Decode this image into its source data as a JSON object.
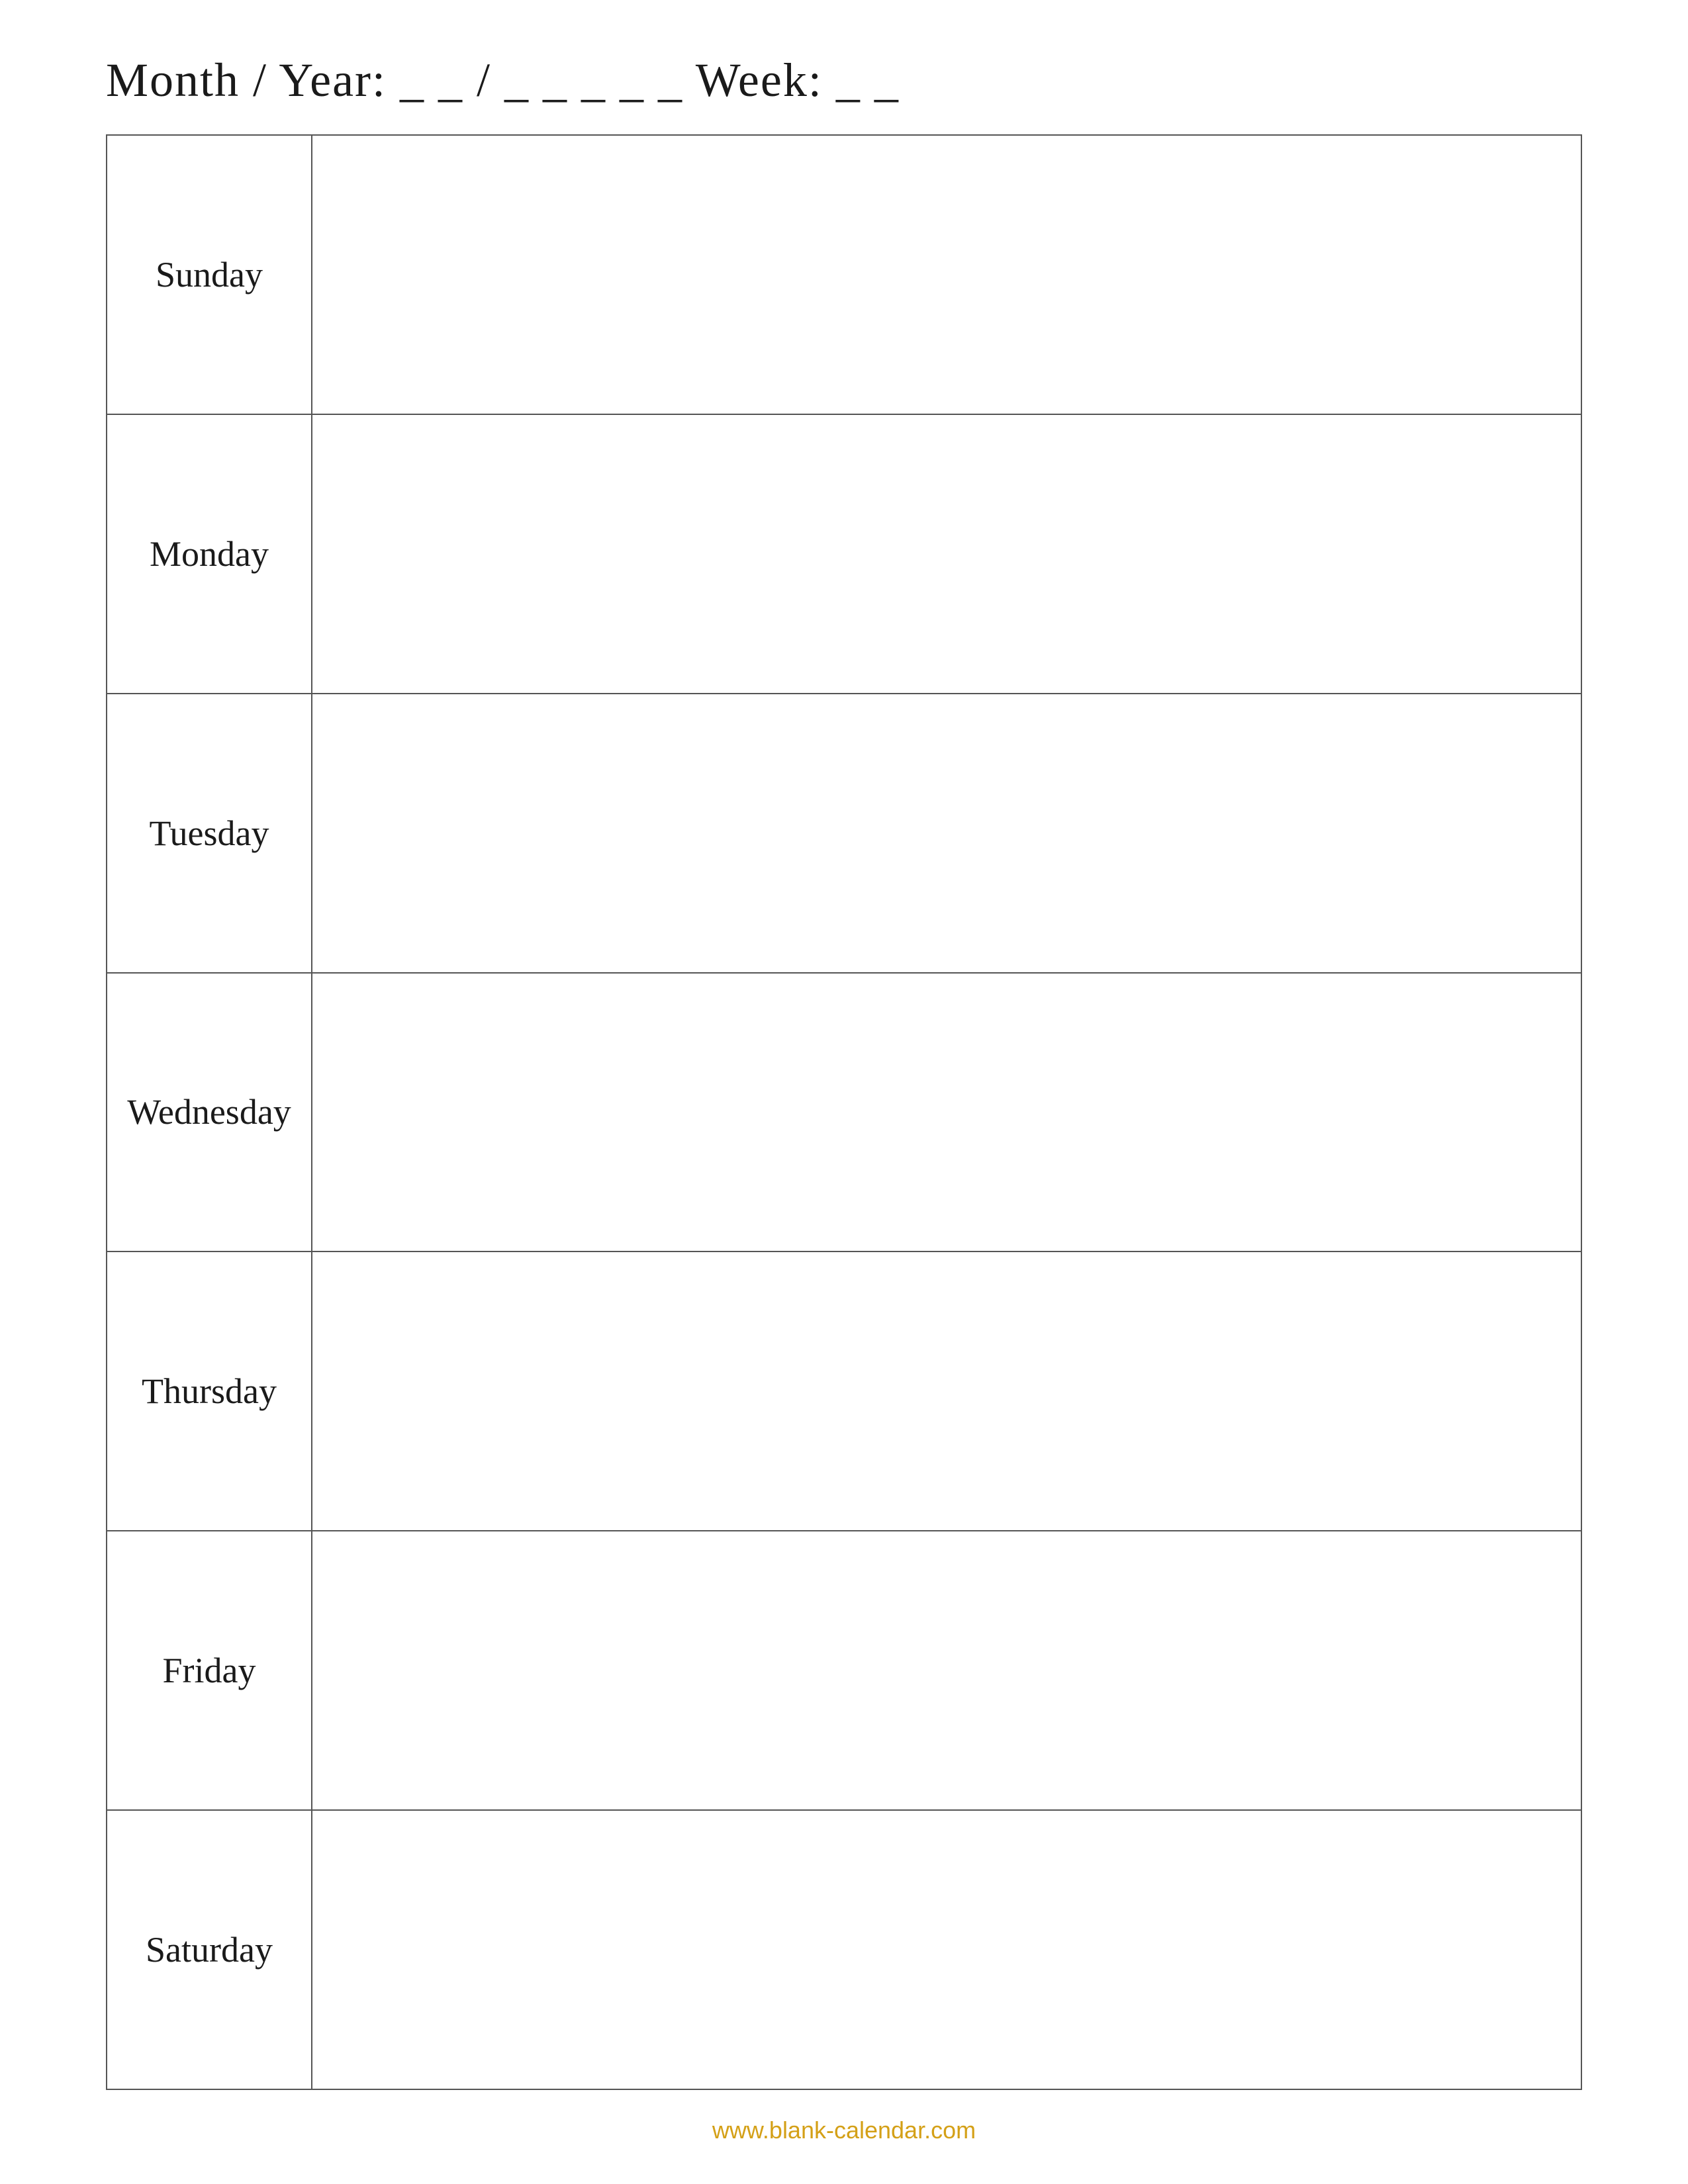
{
  "header": {
    "text": "Month / Year: _ _ / _ _ _ _ _ Week: _ _"
  },
  "days": [
    {
      "id": "sunday",
      "label": "Sunday"
    },
    {
      "id": "monday",
      "label": "Monday"
    },
    {
      "id": "tuesday",
      "label": "Tuesday"
    },
    {
      "id": "wednesday",
      "label": "Wednesday"
    },
    {
      "id": "thursday",
      "label": "Thursday"
    },
    {
      "id": "friday",
      "label": "Friday"
    },
    {
      "id": "saturday",
      "label": "Saturday"
    }
  ],
  "footer": {
    "url": "www.blank-calendar.com"
  }
}
